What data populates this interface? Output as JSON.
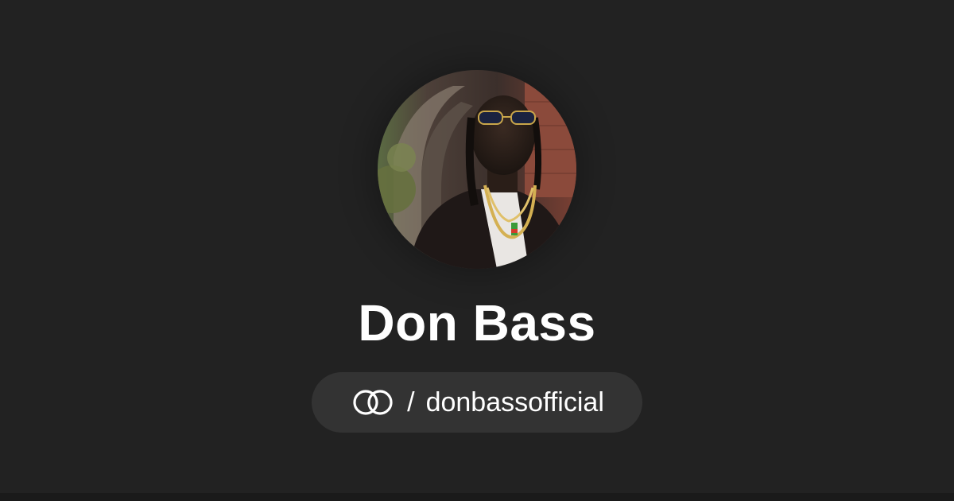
{
  "profile": {
    "name": "Don Bass",
    "avatar_icon": "profile-photo",
    "handle_separator": "/",
    "handle": "donbassofficial",
    "link_icon": "linktree-rings-icon"
  },
  "colors": {
    "background": "#222222",
    "pill_background": "#333333",
    "text": "#ffffff"
  }
}
